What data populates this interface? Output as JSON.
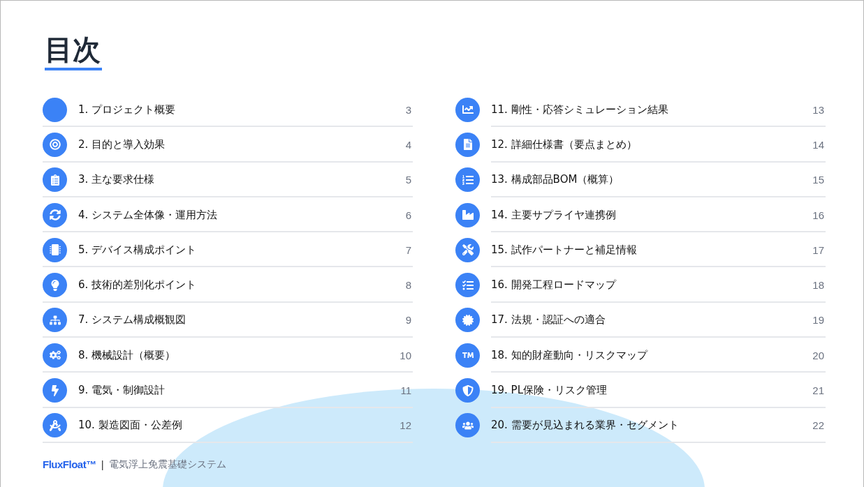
{
  "title": "目次",
  "columns": [
    {
      "items": [
        {
          "kind": "blank",
          "label": "1. プロジェクト概要",
          "page": "3"
        },
        {
          "kind": "target",
          "label": "2. 目的と導入効果",
          "page": "4"
        },
        {
          "kind": "clipboard",
          "label": "3. 主な要求仕様",
          "page": "5"
        },
        {
          "kind": "sync",
          "label": "4. システム全体像・運用方法",
          "page": "6"
        },
        {
          "kind": "chip",
          "label": "5. デバイス構成ポイント",
          "page": "7"
        },
        {
          "kind": "bulb",
          "label": "6. 技術的差別化ポイント",
          "page": "8"
        },
        {
          "kind": "sitemap",
          "label": "7. システム構成概観図",
          "page": "9"
        },
        {
          "kind": "gears",
          "label": "8. 機械設計（概要）",
          "page": "10"
        },
        {
          "kind": "bolt",
          "label": "9. 電気・制御設計",
          "page": "11"
        },
        {
          "kind": "compass",
          "label": "10. 製造図面・公差例",
          "page": "12"
        }
      ]
    },
    {
      "items": [
        {
          "kind": "chart",
          "label": "11. 剛性・応答シミュレーション結果",
          "page": "13"
        },
        {
          "kind": "document",
          "label": "12. 詳細仕様書（要点まとめ）",
          "page": "14"
        },
        {
          "kind": "numbered",
          "label": "13. 構成部品BOM（概算）",
          "page": "15"
        },
        {
          "kind": "factory",
          "label": "14. 主要サプライヤ連携例",
          "page": "16"
        },
        {
          "kind": "tools",
          "label": "15. 試作パートナーと補足情報",
          "page": "17"
        },
        {
          "kind": "checklist",
          "label": "16. 開発工程ロードマップ",
          "page": "18"
        },
        {
          "kind": "seal",
          "label": "17. 法規・認証への適合",
          "page": "19"
        },
        {
          "kind": "trademark",
          "label": "18. 知的財産動向・リスクマップ",
          "page": "20"
        },
        {
          "kind": "shield",
          "label": "19. PL保険・リスク管理",
          "page": "21"
        },
        {
          "kind": "people",
          "label": "20. 需要が見込まれる業界・セグメント",
          "page": "22"
        }
      ]
    }
  ],
  "footer": {
    "brand": "FluxFloat™",
    "separator": "|",
    "subtitle": "電気浮上免震基礎システム"
  }
}
